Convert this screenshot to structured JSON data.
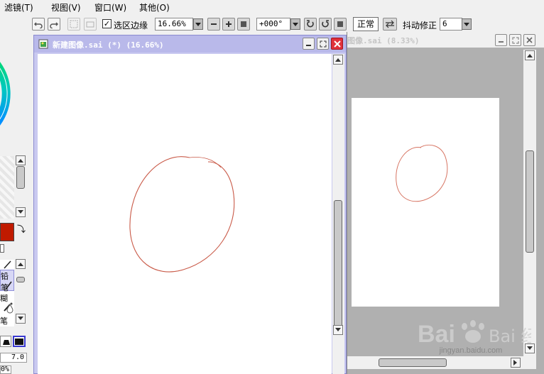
{
  "menubar": {
    "items": [
      {
        "label": "滤镜(T)"
      },
      {
        "label": "视图(V)"
      },
      {
        "label": "窗口(W)"
      },
      {
        "label": "其他(O)"
      }
    ]
  },
  "toolbar": {
    "selection_edge_label": "选区边缘",
    "selection_edge_checked": "✓",
    "zoom_value": "16.66%",
    "angle_value": "+000°",
    "blend_mode": "正常",
    "stabilizer_label": "抖动修正",
    "stabilizer_value": "6"
  },
  "left_panel": {
    "brush_name_fragment": "铅笔",
    "tool_fragment_1": "糊",
    "tool_fragment_2": "笔",
    "size_value": "7.0",
    "opacity_fragment": "0%",
    "primary_color": "#c01a00"
  },
  "window_active": {
    "title": "新建图像.sai (*) (16.66%)"
  },
  "window_back": {
    "title": "图像.sai (8.33%)"
  },
  "watermark": {
    "brand_text": "Bai  经验",
    "url": "jingyan.baidu.com"
  },
  "colors": {
    "active_title_bar": "#b9b9ea",
    "stroke_color": "#c95a48",
    "close_button": "#e0303a"
  }
}
